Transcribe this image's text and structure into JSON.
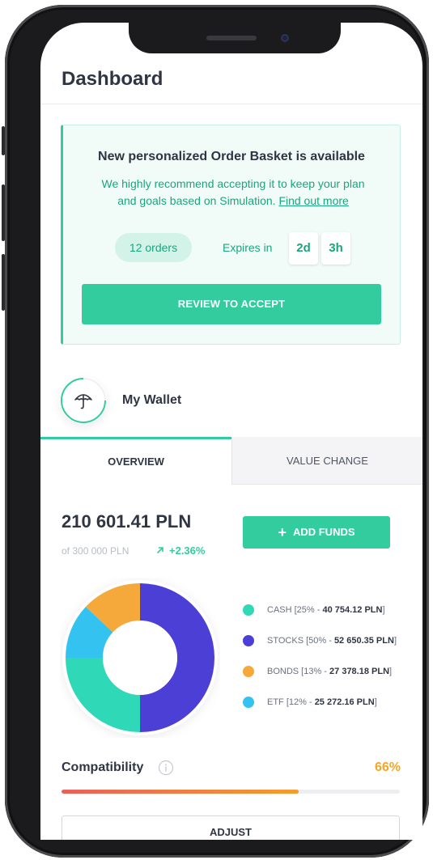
{
  "header": {
    "title": "Dashboard"
  },
  "basket": {
    "title": "New personalized Order Basket is available",
    "text_line1": "We highly recommend accepting it to keep your plan",
    "text_line2": "and goals based on Simulation.",
    "link": "Find out more",
    "orders": "12 orders",
    "expires_label": "Expires in",
    "days": "2d",
    "hours": "3h",
    "review_button": "REVIEW TO ACCEPT"
  },
  "wallet": {
    "title": "My Wallet",
    "icon": "umbrella-icon"
  },
  "tabs": [
    {
      "label": "OVERVIEW",
      "active": true
    },
    {
      "label": "VALUE CHANGE",
      "active": false
    }
  ],
  "overview": {
    "balance": "210 601.41 PLN",
    "of_total": "of 300 000 PLN",
    "change": "+2.36%",
    "change_icon": "arrow-up-right-icon",
    "add_funds_button": "ADD FUNDS"
  },
  "allocation": [
    {
      "name": "CASH",
      "percent": 25,
      "prefix": "CASH [25% - ",
      "amount": "40 754.12 PLN",
      "suffix": "]",
      "color": "#2fd8b6"
    },
    {
      "name": "STOCKS",
      "percent": 50,
      "prefix": "STOCKS [50% - ",
      "amount": "52 650.35 PLN",
      "suffix": "]",
      "color": "#4b3fd6"
    },
    {
      "name": "BONDS",
      "percent": 13,
      "prefix": "BONDS [13% - ",
      "amount": "27 378.18 PLN",
      "suffix": "]",
      "color": "#f5a93a"
    },
    {
      "name": "ETF",
      "percent": 12,
      "prefix": "ETF [12% - ",
      "amount": "25 272.16 PLN",
      "suffix": "]",
      "color": "#34c3f0"
    }
  ],
  "compatibility": {
    "label": "Compatibility",
    "value_text": "66%",
    "value": 0.7,
    "adjust_button": "ADJUST"
  },
  "colors": {
    "accent": "#33cc9e",
    "warning": "#f5a623",
    "text": "#2f3542"
  }
}
